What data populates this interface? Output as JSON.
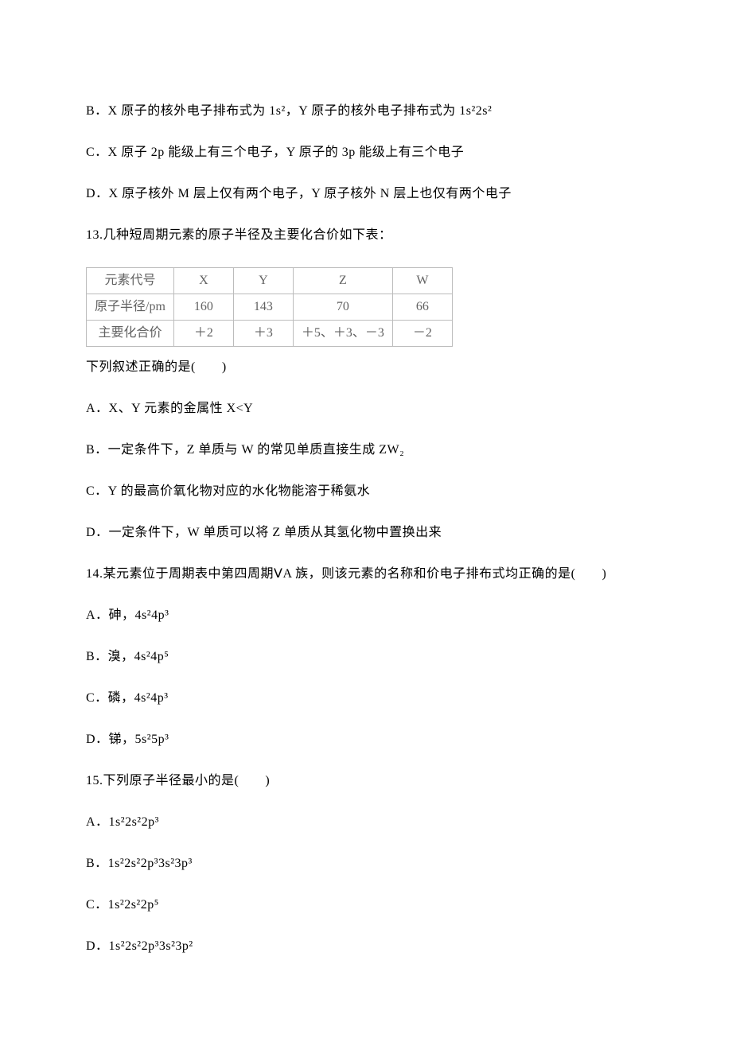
{
  "q12": {
    "B": "B．X 原子的核外电子排布式为 1s²，Y 原子的核外电子排布式为 1s²2s²",
    "C": "C．X 原子 2p 能级上有三个电子，Y 原子的 3p 能级上有三个电子",
    "D": "D．X 原子核外 M 层上仅有两个电子，Y 原子核外 N 层上也仅有两个电子"
  },
  "q13": {
    "stem": "13.几种短周期元素的原子半径及主要化合价如下表：",
    "table": {
      "r0": [
        "元素代号",
        "X",
        "Y",
        "Z",
        "W"
      ],
      "r1": [
        "原子半径/pm",
        "160",
        "143",
        "70",
        "66"
      ],
      "r2": [
        "主要化合价",
        "＋2",
        "＋3",
        "＋5、＋3、－3",
        "－2"
      ]
    },
    "after": "下列叙述正确的是(　　)",
    "A": "A．X、Y 元素的金属性 X<Y",
    "B": "B．一定条件下，Z 单质与 W 的常见单质直接生成 ZW₂",
    "C": "C．Y 的最高价氧化物对应的水化物能溶于稀氨水",
    "D": "D．一定条件下，W 单质可以将 Z 单质从其氢化物中置换出来"
  },
  "q14": {
    "stem": "14.某元素位于周期表中第四周期ⅤA 族，则该元素的名称和价电子排布式均正确的是(　　)",
    "A": "A．砷，4s²4p³",
    "B": "B．溴，4s²4p⁵",
    "C": "C．磷，4s²4p³",
    "D": "D．锑，5s²5p³"
  },
  "q15": {
    "stem": "15.下列原子半径最小的是(　　)",
    "A": "A．1s²2s²2p³",
    "B": "B．1s²2s²2p³3s²3p³",
    "C": "C．1s²2s²2p⁵",
    "D": "D．1s²2s²2p³3s²3p²"
  },
  "chart_data": {
    "type": "table",
    "title": "几种短周期元素的原子半径及主要化合价",
    "columns": [
      "元素代号",
      "X",
      "Y",
      "Z",
      "W"
    ],
    "rows": [
      {
        "label": "原子半径/pm",
        "values": [
          160,
          143,
          70,
          66
        ]
      },
      {
        "label": "主要化合价",
        "values": [
          "+2",
          "+3",
          "+5,+3,-3",
          "-2"
        ]
      }
    ]
  }
}
